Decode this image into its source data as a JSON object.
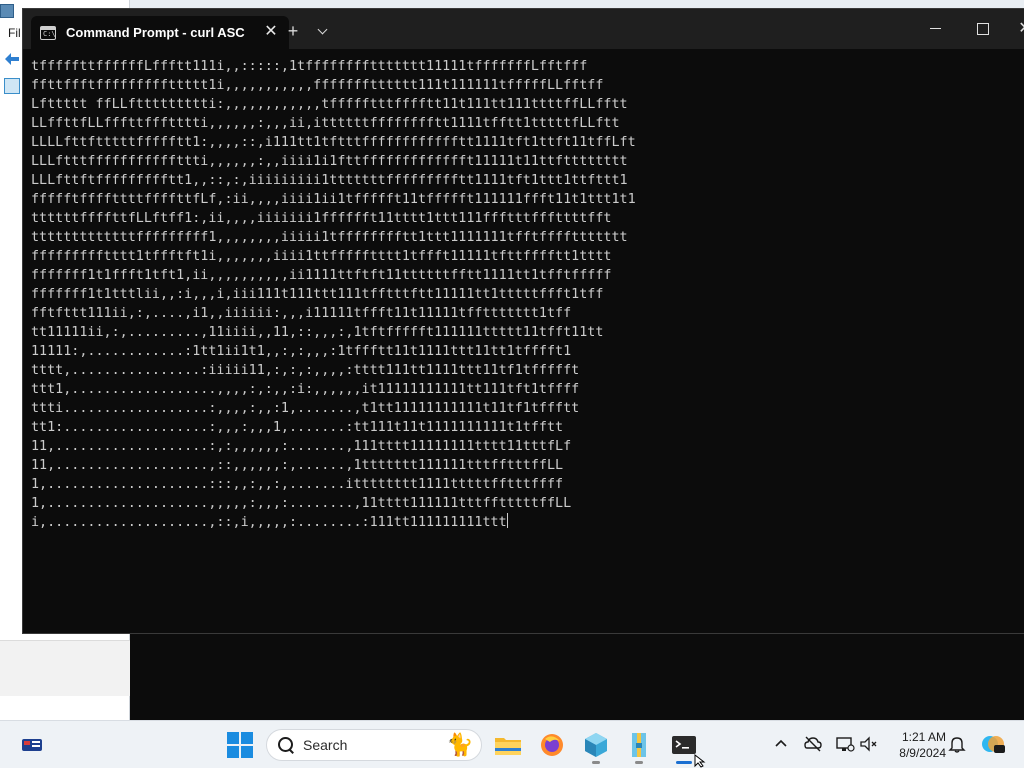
{
  "background_window": {
    "menu_label": "Fil"
  },
  "terminal": {
    "tab_title": "Command Prompt - curl  ASC",
    "tab_icon_glyph": "C:\\",
    "new_tab_label": "+",
    "close_glyph": "✕",
    "output_lines": [
      "tfffffttffffffLffftt111i,,:::::,1tffffffffttttttt11111tfffffffLfftfff",
      "ffttffftfffffffffttttt1i,,,,,,,,,,,ffffffftttttt111t111111tfffffLLfftff",
      "Lfttttt ffLLfttttttttti:,,,,,,,,,,,,tffffftttfffftt11t111tt111ttttffLLfftt",
      "LLffttfLLfffttffftttti,,,,,,:,,,ii,ittttttfffffffftt1111tfftt1tttttfLLftt",
      "LLLLfttftttttffffftt1:,,,,::,i111tt1tftttfffffffffffftt1111tft1ttft11tffLft",
      "LLLftttfffffffffffttti,,,,,,:,,iiii1i1fttffffffffffffft11111t11ttftttttttt",
      "LLLfttftffffffffftt1,,::,:,iiiiiiiii1tttttttffffffffftt1111tft1ttt1ttfttt1",
      "ffffftffffttttffffttfLf,:ii,,,,iiii1ii1tffffft11tffffft111111ffft11t1ttt1t1",
      "ttttttffffttfLLftff1:,ii,,,,iiiiiii1fffffft11tttt1ttt111ffftttfffttttfft",
      "tttttttttttttfffffffff1,,,,,,,,iiiii1tfffffffftt1ttt1111111tfftffffttttttt",
      "ffffffffftttt1tffftft1i,,,,,,,iiii1ttffffftttt1tffft11111tfttfffftt1tttt",
      "fffffff1t1ffft1tft1,ii,,,,,,,,,,ii1111ttftft11ttttttfftt1111tt1tfftfffff",
      "fffffff1t1tttlii,,:i,,,i,iii111t111ttt111tfftttftt11111tt1tttttffft1tff",
      "fftfttt111ii,:,....,i1,,iiiiii:,,,i11111tffft11t11111tffttttttt1tff",
      "tt11111ii,:,.........,11iiii,,11,::,,,:,1tftffffft111111ttttt11tfft11tt",
      "11111:,............:1tt1ii1t1,,:,:,,,:1tffftt11t1111ttt11tt1tfffft1",
      "tttt,................:iiiii11,:,:,:,,,,:tttt111tt1111ttt11tf1tffffft",
      "ttt1,..................,,,,:,:,,:i:,,,,,,it11111111111tt111tft1tffff",
      "ttti..................:,,,,:,,:1,.......,t1tt11111111111t11tf1tffftt",
      "tt1:..................:,,,:,,,1,.......:tt111t11t1111111111t1tfftt",
      "11,...................:,:,,,,,,:.......,111tttt11111111tttt11tttfLf",
      "11,...................,::,,,,,,:,......,1ttttttt111111tttfftttffLL",
      "1,....................:::,,:,,:,.......itttttttt1111tttttfftttffff",
      "1,....................,,,,,:,,,:........,11tttt111111tttfftttttffLL",
      "i,....................,::,i,,,,,:........:111tt111111111ttt"
    ]
  },
  "taskbar": {
    "search_placeholder": "Search",
    "clock_time": "1:21 AM",
    "clock_date": "8/9/2024"
  }
}
